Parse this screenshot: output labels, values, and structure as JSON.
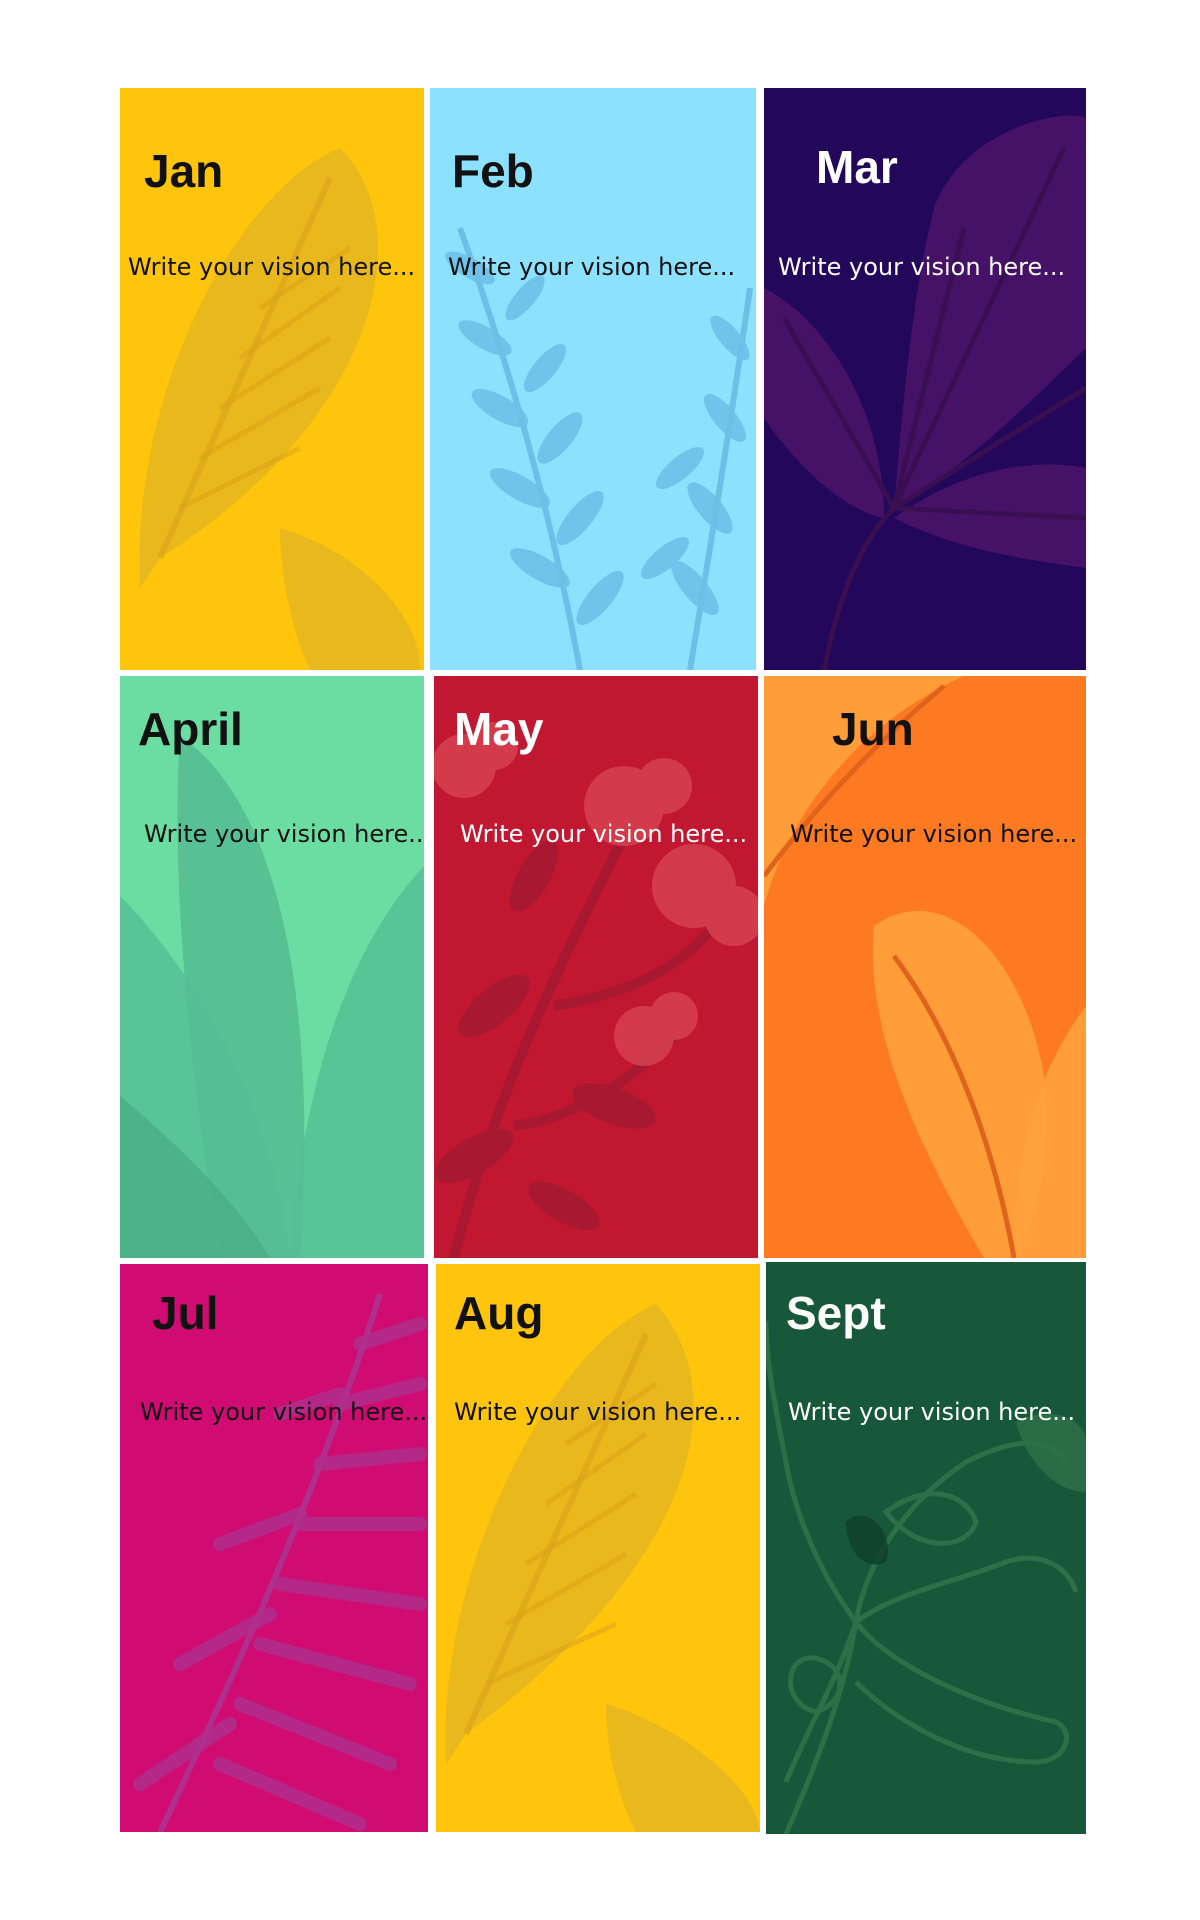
{
  "placeholder": "Write your vision here...",
  "cards": [
    {
      "month": "Jan",
      "bg": "#FEC50C",
      "text": "#111111",
      "leaf": "#E2B322"
    },
    {
      "month": "Feb",
      "bg": "#8CE1FE",
      "text": "#111111",
      "leaf": "#6CC0E8"
    },
    {
      "month": "Mar",
      "bg": "#22075A",
      "text": "#FFFFFF",
      "leaf": "#4A1468"
    },
    {
      "month": "April",
      "bg": "#6CDDA2",
      "text": "#111111",
      "leaf": "#55BE92"
    },
    {
      "month": "May",
      "bg": "#C11730",
      "text": "#FFFFFF",
      "leaf": "#D84452"
    },
    {
      "month": "Jun",
      "bg": "#FE7A22",
      "text": "#111111",
      "leaf": "#FFA33C"
    },
    {
      "month": "Jul",
      "bg": "#D00B72",
      "text": "#111111",
      "leaf": "#B02E8C"
    },
    {
      "month": "Aug",
      "bg": "#FEC50C",
      "text": "#111111",
      "leaf": "#E2B322"
    },
    {
      "month": "Sept",
      "bg": "#17583A",
      "text": "#FFFFFF",
      "leaf": "#2D7048"
    }
  ]
}
